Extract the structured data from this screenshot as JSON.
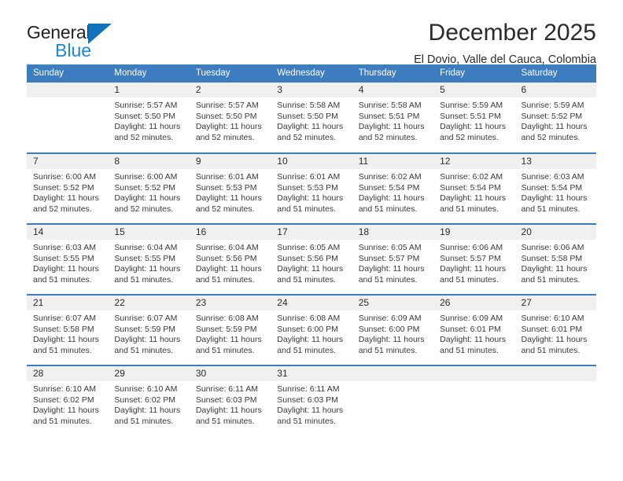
{
  "brand": {
    "name_line1": "General",
    "name_line2": "Blue",
    "triangle_icon": "triangle-icon",
    "accent_dark": "#231f20",
    "accent_blue": "#1b87dd",
    "triangle_blue": "#1271bb"
  },
  "header": {
    "title": "December 2025",
    "subtitle": "El Dovio, Valle del Cauca, Colombia"
  },
  "calendar": {
    "header_background": "#3d7dbf",
    "daynum_background": "#f0f0f0",
    "weekday_headers": [
      "Sunday",
      "Monday",
      "Tuesday",
      "Wednesday",
      "Thursday",
      "Friday",
      "Saturday"
    ],
    "weeks": [
      [
        {
          "day": "",
          "sunrise": "",
          "sunset": "",
          "daylight_line1": "",
          "daylight_line2": ""
        },
        {
          "day": "1",
          "sunrise": "Sunrise: 5:57 AM",
          "sunset": "Sunset: 5:50 PM",
          "daylight_line1": "Daylight: 11 hours",
          "daylight_line2": "and 52 minutes."
        },
        {
          "day": "2",
          "sunrise": "Sunrise: 5:57 AM",
          "sunset": "Sunset: 5:50 PM",
          "daylight_line1": "Daylight: 11 hours",
          "daylight_line2": "and 52 minutes."
        },
        {
          "day": "3",
          "sunrise": "Sunrise: 5:58 AM",
          "sunset": "Sunset: 5:50 PM",
          "daylight_line1": "Daylight: 11 hours",
          "daylight_line2": "and 52 minutes."
        },
        {
          "day": "4",
          "sunrise": "Sunrise: 5:58 AM",
          "sunset": "Sunset: 5:51 PM",
          "daylight_line1": "Daylight: 11 hours",
          "daylight_line2": "and 52 minutes."
        },
        {
          "day": "5",
          "sunrise": "Sunrise: 5:59 AM",
          "sunset": "Sunset: 5:51 PM",
          "daylight_line1": "Daylight: 11 hours",
          "daylight_line2": "and 52 minutes."
        },
        {
          "day": "6",
          "sunrise": "Sunrise: 5:59 AM",
          "sunset": "Sunset: 5:52 PM",
          "daylight_line1": "Daylight: 11 hours",
          "daylight_line2": "and 52 minutes."
        }
      ],
      [
        {
          "day": "7",
          "sunrise": "Sunrise: 6:00 AM",
          "sunset": "Sunset: 5:52 PM",
          "daylight_line1": "Daylight: 11 hours",
          "daylight_line2": "and 52 minutes."
        },
        {
          "day": "8",
          "sunrise": "Sunrise: 6:00 AM",
          "sunset": "Sunset: 5:52 PM",
          "daylight_line1": "Daylight: 11 hours",
          "daylight_line2": "and 52 minutes."
        },
        {
          "day": "9",
          "sunrise": "Sunrise: 6:01 AM",
          "sunset": "Sunset: 5:53 PM",
          "daylight_line1": "Daylight: 11 hours",
          "daylight_line2": "and 52 minutes."
        },
        {
          "day": "10",
          "sunrise": "Sunrise: 6:01 AM",
          "sunset": "Sunset: 5:53 PM",
          "daylight_line1": "Daylight: 11 hours",
          "daylight_line2": "and 51 minutes."
        },
        {
          "day": "11",
          "sunrise": "Sunrise: 6:02 AM",
          "sunset": "Sunset: 5:54 PM",
          "daylight_line1": "Daylight: 11 hours",
          "daylight_line2": "and 51 minutes."
        },
        {
          "day": "12",
          "sunrise": "Sunrise: 6:02 AM",
          "sunset": "Sunset: 5:54 PM",
          "daylight_line1": "Daylight: 11 hours",
          "daylight_line2": "and 51 minutes."
        },
        {
          "day": "13",
          "sunrise": "Sunrise: 6:03 AM",
          "sunset": "Sunset: 5:54 PM",
          "daylight_line1": "Daylight: 11 hours",
          "daylight_line2": "and 51 minutes."
        }
      ],
      [
        {
          "day": "14",
          "sunrise": "Sunrise: 6:03 AM",
          "sunset": "Sunset: 5:55 PM",
          "daylight_line1": "Daylight: 11 hours",
          "daylight_line2": "and 51 minutes."
        },
        {
          "day": "15",
          "sunrise": "Sunrise: 6:04 AM",
          "sunset": "Sunset: 5:55 PM",
          "daylight_line1": "Daylight: 11 hours",
          "daylight_line2": "and 51 minutes."
        },
        {
          "day": "16",
          "sunrise": "Sunrise: 6:04 AM",
          "sunset": "Sunset: 5:56 PM",
          "daylight_line1": "Daylight: 11 hours",
          "daylight_line2": "and 51 minutes."
        },
        {
          "day": "17",
          "sunrise": "Sunrise: 6:05 AM",
          "sunset": "Sunset: 5:56 PM",
          "daylight_line1": "Daylight: 11 hours",
          "daylight_line2": "and 51 minutes."
        },
        {
          "day": "18",
          "sunrise": "Sunrise: 6:05 AM",
          "sunset": "Sunset: 5:57 PM",
          "daylight_line1": "Daylight: 11 hours",
          "daylight_line2": "and 51 minutes."
        },
        {
          "day": "19",
          "sunrise": "Sunrise: 6:06 AM",
          "sunset": "Sunset: 5:57 PM",
          "daylight_line1": "Daylight: 11 hours",
          "daylight_line2": "and 51 minutes."
        },
        {
          "day": "20",
          "sunrise": "Sunrise: 6:06 AM",
          "sunset": "Sunset: 5:58 PM",
          "daylight_line1": "Daylight: 11 hours",
          "daylight_line2": "and 51 minutes."
        }
      ],
      [
        {
          "day": "21",
          "sunrise": "Sunrise: 6:07 AM",
          "sunset": "Sunset: 5:58 PM",
          "daylight_line1": "Daylight: 11 hours",
          "daylight_line2": "and 51 minutes."
        },
        {
          "day": "22",
          "sunrise": "Sunrise: 6:07 AM",
          "sunset": "Sunset: 5:59 PM",
          "daylight_line1": "Daylight: 11 hours",
          "daylight_line2": "and 51 minutes."
        },
        {
          "day": "23",
          "sunrise": "Sunrise: 6:08 AM",
          "sunset": "Sunset: 5:59 PM",
          "daylight_line1": "Daylight: 11 hours",
          "daylight_line2": "and 51 minutes."
        },
        {
          "day": "24",
          "sunrise": "Sunrise: 6:08 AM",
          "sunset": "Sunset: 6:00 PM",
          "daylight_line1": "Daylight: 11 hours",
          "daylight_line2": "and 51 minutes."
        },
        {
          "day": "25",
          "sunrise": "Sunrise: 6:09 AM",
          "sunset": "Sunset: 6:00 PM",
          "daylight_line1": "Daylight: 11 hours",
          "daylight_line2": "and 51 minutes."
        },
        {
          "day": "26",
          "sunrise": "Sunrise: 6:09 AM",
          "sunset": "Sunset: 6:01 PM",
          "daylight_line1": "Daylight: 11 hours",
          "daylight_line2": "and 51 minutes."
        },
        {
          "day": "27",
          "sunrise": "Sunrise: 6:10 AM",
          "sunset": "Sunset: 6:01 PM",
          "daylight_line1": "Daylight: 11 hours",
          "daylight_line2": "and 51 minutes."
        }
      ],
      [
        {
          "day": "28",
          "sunrise": "Sunrise: 6:10 AM",
          "sunset": "Sunset: 6:02 PM",
          "daylight_line1": "Daylight: 11 hours",
          "daylight_line2": "and 51 minutes."
        },
        {
          "day": "29",
          "sunrise": "Sunrise: 6:10 AM",
          "sunset": "Sunset: 6:02 PM",
          "daylight_line1": "Daylight: 11 hours",
          "daylight_line2": "and 51 minutes."
        },
        {
          "day": "30",
          "sunrise": "Sunrise: 6:11 AM",
          "sunset": "Sunset: 6:03 PM",
          "daylight_line1": "Daylight: 11 hours",
          "daylight_line2": "and 51 minutes."
        },
        {
          "day": "31",
          "sunrise": "Sunrise: 6:11 AM",
          "sunset": "Sunset: 6:03 PM",
          "daylight_line1": "Daylight: 11 hours",
          "daylight_line2": "and 51 minutes."
        },
        {
          "day": "",
          "sunrise": "",
          "sunset": "",
          "daylight_line1": "",
          "daylight_line2": ""
        },
        {
          "day": "",
          "sunrise": "",
          "sunset": "",
          "daylight_line1": "",
          "daylight_line2": ""
        },
        {
          "day": "",
          "sunrise": "",
          "sunset": "",
          "daylight_line1": "",
          "daylight_line2": ""
        }
      ]
    ]
  }
}
